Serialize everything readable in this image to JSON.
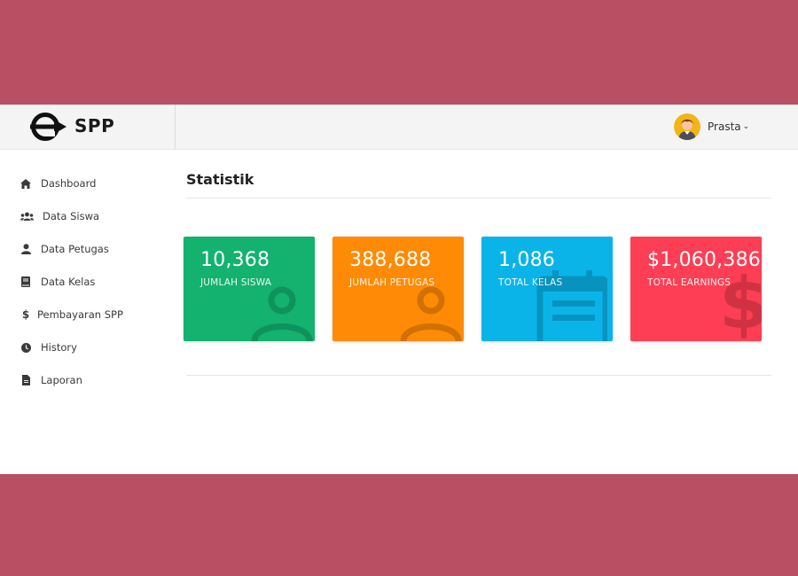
{
  "brand": {
    "name": "SPP"
  },
  "user": {
    "name": "Prasta"
  },
  "sidebar": {
    "items": [
      {
        "label": "Dashboard",
        "icon": "home-icon"
      },
      {
        "label": "Data Siswa",
        "icon": "users-icon"
      },
      {
        "label": "Data Petugas",
        "icon": "user-icon"
      },
      {
        "label": "Data Kelas",
        "icon": "book-icon"
      },
      {
        "label": "Pembayaran SPP",
        "icon": "dollar-icon"
      },
      {
        "label": "History",
        "icon": "clock-icon"
      },
      {
        "label": "Laporan",
        "icon": "file-icon"
      }
    ]
  },
  "main": {
    "title": "Statistik",
    "cards": [
      {
        "value": "10,368",
        "label": "JUMLAH SISWA",
        "color": "#13b26f",
        "icon": "user-icon"
      },
      {
        "value": "388,688",
        "label": "JUMLAH PETUGAS",
        "color": "#ff8a05",
        "icon": "user-icon"
      },
      {
        "value": "1,086",
        "label": "TOTAL KELAS",
        "color": "#0ab4e9",
        "icon": "calendar-icon"
      },
      {
        "value": "$1,060,386",
        "label": "TOTAL EARNINGS",
        "color": "#fe3e54",
        "icon": "dollar-icon"
      }
    ]
  },
  "colors": {
    "background": "#b94f62",
    "topbar": "#f4f4f4"
  }
}
